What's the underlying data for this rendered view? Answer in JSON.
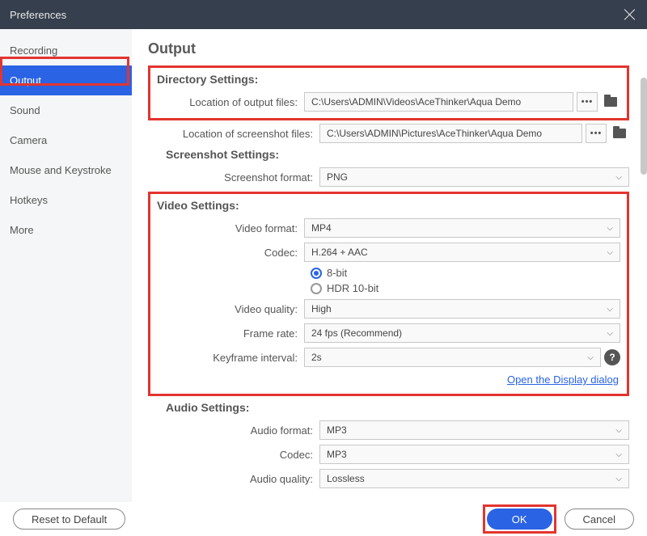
{
  "title": "Preferences",
  "sidebar": {
    "items": [
      {
        "label": "Recording",
        "active": false
      },
      {
        "label": "Output",
        "active": true
      },
      {
        "label": "Sound",
        "active": false
      },
      {
        "label": "Camera",
        "active": false
      },
      {
        "label": "Mouse and Keystroke",
        "active": false
      },
      {
        "label": "Hotkeys",
        "active": false
      },
      {
        "label": "More",
        "active": false
      }
    ]
  },
  "main": {
    "page_title": "Output",
    "directory": {
      "title": "Directory Settings:",
      "output_label": "Location of output files:",
      "output_path": "C:\\Users\\ADMIN\\Videos\\AceThinker\\Aqua Demo",
      "screenshot_label": "Location of screenshot files:",
      "screenshot_path": "C:\\Users\\ADMIN\\Pictures\\AceThinker\\Aqua Demo",
      "browse_label": "•••"
    },
    "screenshot": {
      "title": "Screenshot Settings:",
      "format_label": "Screenshot format:",
      "format_value": "PNG"
    },
    "video": {
      "title": "Video Settings:",
      "format_label": "Video format:",
      "format_value": "MP4",
      "codec_label": "Codec:",
      "codec_value": "H.264 + AAC",
      "bit8_label": "8-bit",
      "hdr_label": "HDR 10-bit",
      "quality_label": "Video quality:",
      "quality_value": "High",
      "fps_label": "Frame rate:",
      "fps_value": "24 fps (Recommend)",
      "keyframe_label": "Keyframe interval:",
      "keyframe_value": "2s",
      "display_link": "Open the Display dialog"
    },
    "audio": {
      "title": "Audio Settings:",
      "format_label": "Audio format:",
      "format_value": "MP3",
      "codec_label": "Codec:",
      "codec_value": "MP3",
      "quality_label": "Audio quality:",
      "quality_value": "Lossless"
    }
  },
  "footer": {
    "reset_label": "Reset to Default",
    "ok_label": "OK",
    "cancel_label": "Cancel"
  }
}
